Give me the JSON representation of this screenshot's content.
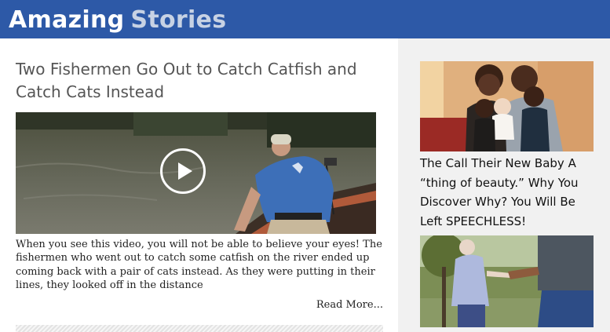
{
  "header": {
    "logo_word1": "Amazing",
    "logo_word2": "Stories",
    "bg_color": "#2d59a7"
  },
  "article": {
    "title": "Two Fishermen Go Out to Catch Catfish and Catch Cats Instead",
    "excerpt": "When you see this video, you will not be able to believe your eyes! The fishermen who went out to catch some catfish on the river ended up coming back with a pair of cats instead. As they were putting in their lines, they looked off in the distance",
    "read_more": "Read More...",
    "video_play_icon": "play-icon"
  },
  "sidebar": {
    "items": [
      {
        "title": "The Call Their New Baby A “thing of beauty.” Why You Discover Why? You Will Be Left SPEECHLESS!"
      },
      {
        "title": ""
      }
    ]
  }
}
